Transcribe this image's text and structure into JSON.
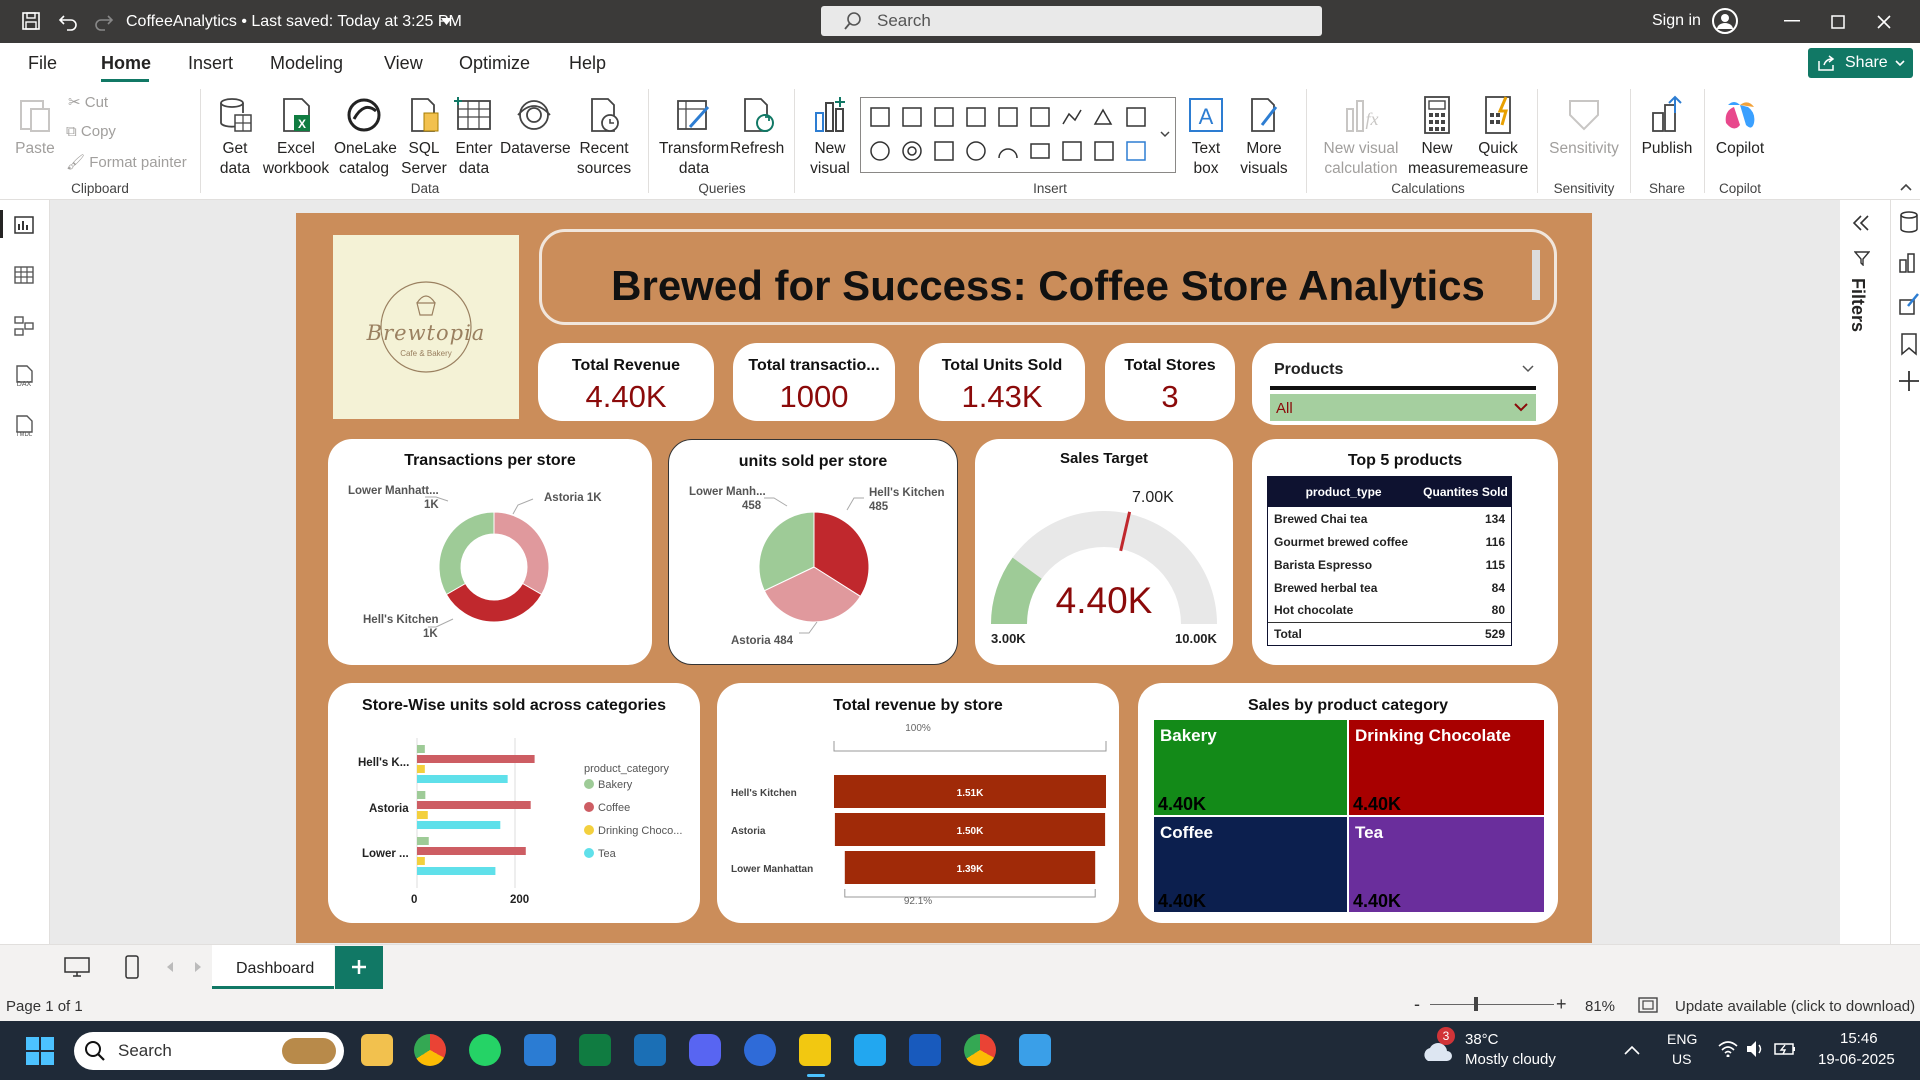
{
  "titlebar": {
    "doc_title": "CoffeeAnalytics • Last saved: Today at 3:25 PM",
    "search_placeholder": "Search",
    "signin": "Sign in"
  },
  "menu": {
    "items": [
      "File",
      "Home",
      "Insert",
      "Modeling",
      "View",
      "Optimize",
      "Help"
    ],
    "active": "Home",
    "share": "Share"
  },
  "ribbon": {
    "clipboard": {
      "paste": "Paste",
      "cut": "Cut",
      "copy": "Copy",
      "format_painter": "Format painter",
      "group": "Clipboard"
    },
    "data": {
      "get_data": "Get data",
      "excel": "Excel workbook",
      "onelake": "OneLake catalog",
      "sql": "SQL Server",
      "enter": "Enter data",
      "dataverse": "Dataverse",
      "recent": "Recent sources",
      "group": "Data"
    },
    "queries": {
      "transform": "Transform data",
      "refresh": "Refresh",
      "group": "Queries"
    },
    "insert": {
      "new_visual": "New visual",
      "text_box": "Text box",
      "more_visuals": "More visuals",
      "group": "Insert"
    },
    "calculations": {
      "new_visual_calc": "New visual calculation",
      "new_measure": "New measure",
      "quick_measure": "Quick measure",
      "group": "Calculations"
    },
    "sensitivity": {
      "label": "Sensitivity",
      "group": "Sensitivity"
    },
    "share": {
      "publish": "Publish",
      "group": "Share"
    },
    "copilot": {
      "label": "Copilot",
      "group": "Copilot"
    }
  },
  "report": {
    "title": "Brewed for Success: Coffee Store Analytics",
    "logo": {
      "name": "Brewtopia",
      "tagline": "Cafe & Bakery"
    },
    "kpis": [
      {
        "label": "Total Revenue",
        "value": "4.40K"
      },
      {
        "label": "Total transactio...",
        "value": "1000"
      },
      {
        "label": "Total Units Sold",
        "value": "1.43K"
      },
      {
        "label": "Total Stores",
        "value": "3"
      }
    ],
    "slicer": {
      "label": "Products",
      "value": "All"
    },
    "transactions_chart": {
      "title": "Transactions per store",
      "labels": [
        "Lower Manhatt...",
        "1K",
        "Astoria 1K",
        "Hell's Kitchen",
        "1K"
      ]
    },
    "units_chart": {
      "title": "units sold per store",
      "labels": [
        "Lower Manh...",
        "458",
        "Hell's Kitchen",
        "485",
        "Astoria 484"
      ]
    },
    "gauge": {
      "title": "Sales Target",
      "value": "4.40K",
      "target": "7.00K",
      "min": "3.00K",
      "max": "10.00K"
    },
    "top5": {
      "title": "Top 5 products",
      "col1": "product_type",
      "col2": "Quantites Sold",
      "rows": [
        {
          "name": "Brewed Chai tea",
          "qty": "134"
        },
        {
          "name": "Gourmet brewed coffee",
          "qty": "116"
        },
        {
          "name": "Barista Espresso",
          "qty": "115"
        },
        {
          "name": "Brewed herbal tea",
          "qty": "84"
        },
        {
          "name": "Hot chocolate",
          "qty": "80"
        }
      ],
      "total_label": "Total",
      "total": "529"
    },
    "storewise": {
      "title": "Store-Wise units sold across categories",
      "legend_title": "product_category",
      "stores": [
        "Hell's K...",
        "Astoria",
        "Lower ..."
      ],
      "categories": [
        "Bakery",
        "Coffee",
        "Drinking Choco...",
        "Tea"
      ],
      "ticks": [
        "0",
        "200"
      ]
    },
    "revenue_by_store": {
      "title": "Total revenue by store",
      "top_pct": "100%",
      "bottom_pct": "92.1%"
    },
    "category_treemap": {
      "title": "Sales by product category",
      "tiles": [
        {
          "name": "Bakery",
          "value": "4.40K"
        },
        {
          "name": "Drinking Chocolate",
          "value": "4.40K"
        },
        {
          "name": "Coffee",
          "value": "4.40K"
        },
        {
          "name": "Tea",
          "value": "4.40K"
        }
      ]
    }
  },
  "chart_data": [
    {
      "type": "pie",
      "title": "Transactions per store",
      "categories": [
        "Astoria",
        "Hell's Kitchen",
        "Lower Manhattan"
      ],
      "values": [
        1000,
        1000,
        1000
      ],
      "colors": [
        "#e0999d",
        "#c0282d",
        "#9ecb97"
      ]
    },
    {
      "type": "pie",
      "title": "units sold per store",
      "categories": [
        "Hell's Kitchen",
        "Astoria",
        "Lower Manhattan"
      ],
      "values": [
        485,
        484,
        458
      ],
      "colors": [
        "#c0282d",
        "#e0999d",
        "#9ecb97"
      ]
    },
    {
      "type": "gauge",
      "title": "Sales Target",
      "value": 4400,
      "target": 7000,
      "min": 3000,
      "max": 10000
    },
    {
      "type": "bar",
      "title": "Store-Wise units sold across categories",
      "categories": [
        "Hell's Kitchen",
        "Astoria",
        "Lower Manhattan"
      ],
      "series": [
        {
          "name": "Bakery",
          "values": [
            16,
            17,
            24
          ],
          "color": "#9ecb97"
        },
        {
          "name": "Coffee",
          "values": [
            240,
            232,
            222
          ],
          "color": "#cd5d63"
        },
        {
          "name": "Drinking Chocolate",
          "values": [
            16,
            22,
            16
          ],
          "color": "#f3d03e"
        },
        {
          "name": "Tea",
          "values": [
            185,
            170,
            160
          ],
          "color": "#5fe0ea"
        }
      ],
      "xlim": [
        0,
        250
      ]
    },
    {
      "type": "bar",
      "title": "Total revenue by store",
      "categories": [
        "Hell's Kitchen",
        "Astoria",
        "Lower Manhattan"
      ],
      "values": [
        1510,
        1500,
        1390
      ],
      "labels": [
        "1.51K",
        "1.50K",
        "1.39K"
      ],
      "color": "#a02a08"
    },
    {
      "type": "treemap",
      "title": "Sales by product category",
      "categories": [
        "Bakery",
        "Drinking Chocolate",
        "Coffee",
        "Tea"
      ],
      "values": [
        4400,
        4400,
        4400,
        4400
      ],
      "colors": [
        "#138a18",
        "#a80000",
        "#0c1f4e",
        "#6a2e9c"
      ]
    }
  ],
  "tabs": {
    "page": "Dashboard"
  },
  "status": {
    "page": "Page 1 of 1",
    "zoom": "81%",
    "update": "Update available (click to download)"
  },
  "taskbar": {
    "search": "Search",
    "weather_temp": "38°C",
    "weather_desc": "Mostly cloudy",
    "lang1": "ENG",
    "lang2": "US",
    "time": "15:46",
    "date": "19-06-2025",
    "badge": "3"
  }
}
